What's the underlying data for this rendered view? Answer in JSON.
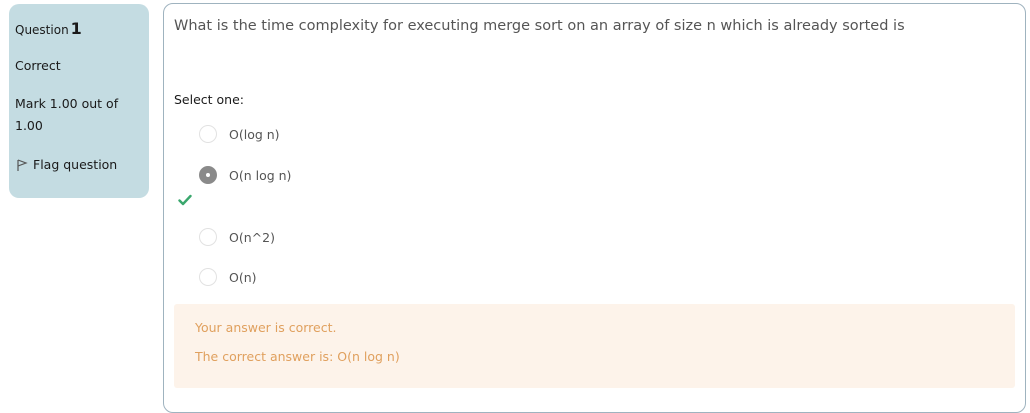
{
  "info": {
    "question_label": "Question",
    "question_number": "1",
    "state": "Correct",
    "grade": "Mark 1.00 out of 1.00",
    "flag_label": "Flag question"
  },
  "question": {
    "text": "What is the time complexity for executing merge sort on an array of size n which is already sorted is",
    "prompt": "Select one:",
    "options": [
      {
        "label": "O(log n)",
        "selected": false
      },
      {
        "label": "O(n log n)",
        "selected": true
      },
      {
        "label": "O(n^2)",
        "selected": false
      },
      {
        "label": "O(n)",
        "selected": false
      }
    ]
  },
  "feedback": {
    "result": "Your answer is correct.",
    "correct_answer": "The correct answer is: O(n log n)"
  },
  "colors": {
    "info_background": "#c4dce2",
    "feedback_background": "#fdf3ea",
    "feedback_text": "#e0a05e",
    "correct_check": "#3aa76d"
  }
}
